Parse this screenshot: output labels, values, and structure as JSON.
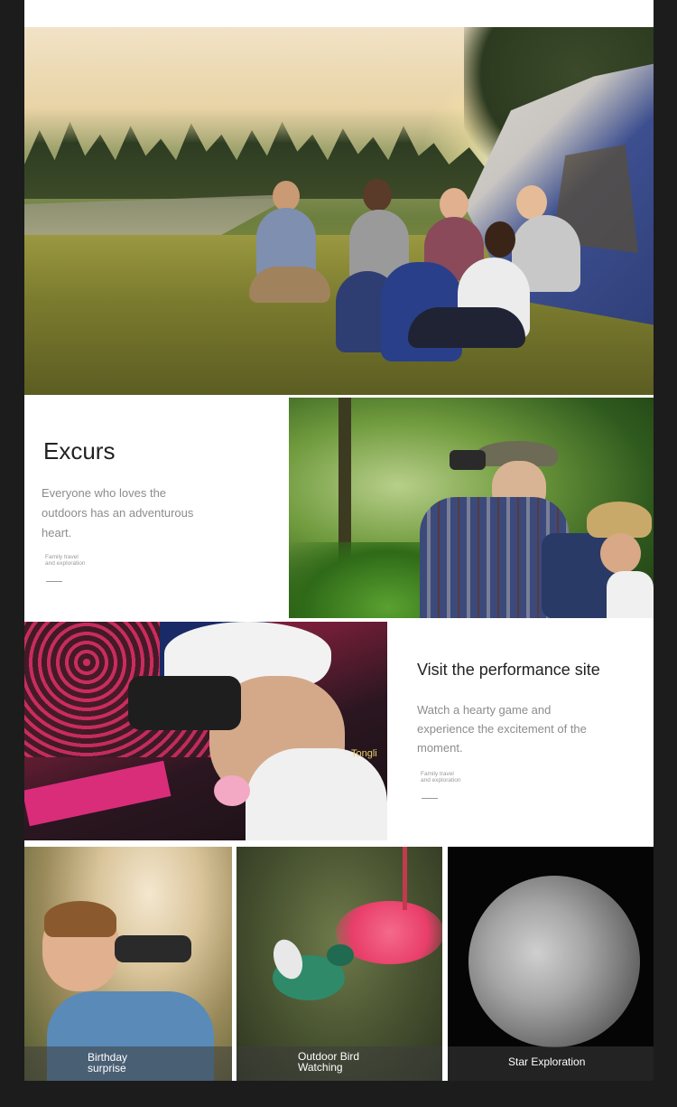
{
  "excursion": {
    "title": "Excurs",
    "description": "Everyone who loves the outdoors has an adventurous heart.",
    "tag_line1": "Family travel",
    "tag_line2": "and exploration"
  },
  "performance": {
    "title": "Visit the performance site",
    "description": "Watch a hearty game and experience the excitement of the moment.",
    "tag_line1": "Family travel",
    "tag_line2": "and exploration",
    "watermark": "Tongli"
  },
  "tiles": [
    {
      "line1": "Birthday",
      "line2": "surprise"
    },
    {
      "line1": "Outdoor Bird",
      "line2": "Watching"
    },
    {
      "line1": "Star Exploration",
      "line2": ""
    }
  ]
}
